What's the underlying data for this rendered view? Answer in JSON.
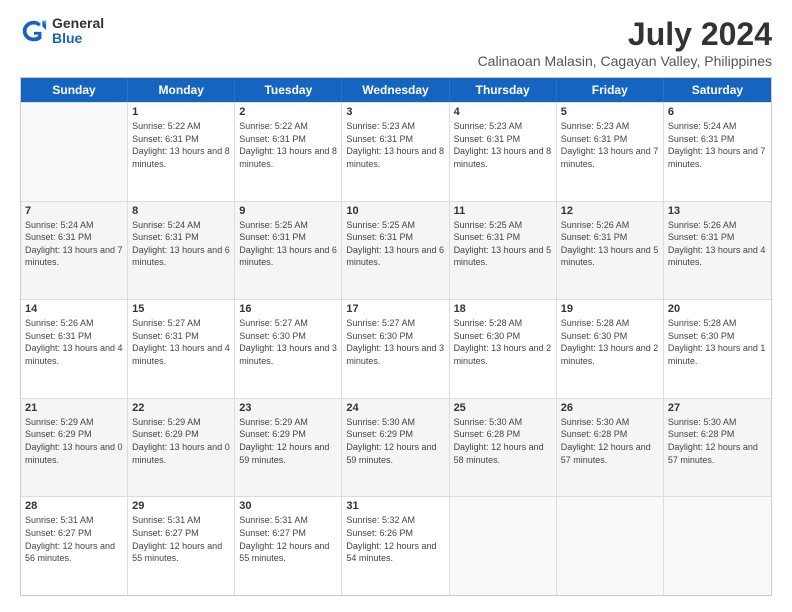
{
  "logo": {
    "general": "General",
    "blue": "Blue"
  },
  "title": "July 2024",
  "subtitle": "Calinaoan Malasin, Cagayan Valley, Philippines",
  "header_days": [
    "Sunday",
    "Monday",
    "Tuesday",
    "Wednesday",
    "Thursday",
    "Friday",
    "Saturday"
  ],
  "weeks": [
    [
      {
        "day": "",
        "info": ""
      },
      {
        "day": "1",
        "info": "Sunrise: 5:22 AM\nSunset: 6:31 PM\nDaylight: 13 hours\nand 8 minutes."
      },
      {
        "day": "2",
        "info": "Sunrise: 5:22 AM\nSunset: 6:31 PM\nDaylight: 13 hours\nand 8 minutes."
      },
      {
        "day": "3",
        "info": "Sunrise: 5:23 AM\nSunset: 6:31 PM\nDaylight: 13 hours\nand 8 minutes."
      },
      {
        "day": "4",
        "info": "Sunrise: 5:23 AM\nSunset: 6:31 PM\nDaylight: 13 hours\nand 8 minutes."
      },
      {
        "day": "5",
        "info": "Sunrise: 5:23 AM\nSunset: 6:31 PM\nDaylight: 13 hours\nand 7 minutes."
      },
      {
        "day": "6",
        "info": "Sunrise: 5:24 AM\nSunset: 6:31 PM\nDaylight: 13 hours\nand 7 minutes."
      }
    ],
    [
      {
        "day": "7",
        "info": "Sunrise: 5:24 AM\nSunset: 6:31 PM\nDaylight: 13 hours\nand 7 minutes."
      },
      {
        "day": "8",
        "info": "Sunrise: 5:24 AM\nSunset: 6:31 PM\nDaylight: 13 hours\nand 6 minutes."
      },
      {
        "day": "9",
        "info": "Sunrise: 5:25 AM\nSunset: 6:31 PM\nDaylight: 13 hours\nand 6 minutes."
      },
      {
        "day": "10",
        "info": "Sunrise: 5:25 AM\nSunset: 6:31 PM\nDaylight: 13 hours\nand 6 minutes."
      },
      {
        "day": "11",
        "info": "Sunrise: 5:25 AM\nSunset: 6:31 PM\nDaylight: 13 hours\nand 5 minutes."
      },
      {
        "day": "12",
        "info": "Sunrise: 5:26 AM\nSunset: 6:31 PM\nDaylight: 13 hours\nand 5 minutes."
      },
      {
        "day": "13",
        "info": "Sunrise: 5:26 AM\nSunset: 6:31 PM\nDaylight: 13 hours\nand 4 minutes."
      }
    ],
    [
      {
        "day": "14",
        "info": "Sunrise: 5:26 AM\nSunset: 6:31 PM\nDaylight: 13 hours\nand 4 minutes."
      },
      {
        "day": "15",
        "info": "Sunrise: 5:27 AM\nSunset: 6:31 PM\nDaylight: 13 hours\nand 4 minutes."
      },
      {
        "day": "16",
        "info": "Sunrise: 5:27 AM\nSunset: 6:30 PM\nDaylight: 13 hours\nand 3 minutes."
      },
      {
        "day": "17",
        "info": "Sunrise: 5:27 AM\nSunset: 6:30 PM\nDaylight: 13 hours\nand 3 minutes."
      },
      {
        "day": "18",
        "info": "Sunrise: 5:28 AM\nSunset: 6:30 PM\nDaylight: 13 hours\nand 2 minutes."
      },
      {
        "day": "19",
        "info": "Sunrise: 5:28 AM\nSunset: 6:30 PM\nDaylight: 13 hours\nand 2 minutes."
      },
      {
        "day": "20",
        "info": "Sunrise: 5:28 AM\nSunset: 6:30 PM\nDaylight: 13 hours\nand 1 minute."
      }
    ],
    [
      {
        "day": "21",
        "info": "Sunrise: 5:29 AM\nSunset: 6:29 PM\nDaylight: 13 hours\nand 0 minutes."
      },
      {
        "day": "22",
        "info": "Sunrise: 5:29 AM\nSunset: 6:29 PM\nDaylight: 13 hours\nand 0 minutes."
      },
      {
        "day": "23",
        "info": "Sunrise: 5:29 AM\nSunset: 6:29 PM\nDaylight: 12 hours\nand 59 minutes."
      },
      {
        "day": "24",
        "info": "Sunrise: 5:30 AM\nSunset: 6:29 PM\nDaylight: 12 hours\nand 59 minutes."
      },
      {
        "day": "25",
        "info": "Sunrise: 5:30 AM\nSunset: 6:28 PM\nDaylight: 12 hours\nand 58 minutes."
      },
      {
        "day": "26",
        "info": "Sunrise: 5:30 AM\nSunset: 6:28 PM\nDaylight: 12 hours\nand 57 minutes."
      },
      {
        "day": "27",
        "info": "Sunrise: 5:30 AM\nSunset: 6:28 PM\nDaylight: 12 hours\nand 57 minutes."
      }
    ],
    [
      {
        "day": "28",
        "info": "Sunrise: 5:31 AM\nSunset: 6:27 PM\nDaylight: 12 hours\nand 56 minutes."
      },
      {
        "day": "29",
        "info": "Sunrise: 5:31 AM\nSunset: 6:27 PM\nDaylight: 12 hours\nand 55 minutes."
      },
      {
        "day": "30",
        "info": "Sunrise: 5:31 AM\nSunset: 6:27 PM\nDaylight: 12 hours\nand 55 minutes."
      },
      {
        "day": "31",
        "info": "Sunrise: 5:32 AM\nSunset: 6:26 PM\nDaylight: 12 hours\nand 54 minutes."
      },
      {
        "day": "",
        "info": ""
      },
      {
        "day": "",
        "info": ""
      },
      {
        "day": "",
        "info": ""
      }
    ]
  ]
}
